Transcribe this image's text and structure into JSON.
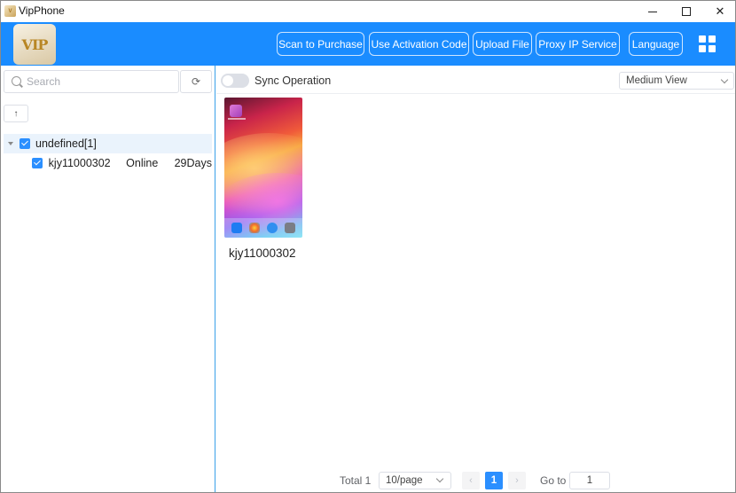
{
  "window": {
    "title": "VipPhone",
    "app_icon": "vip-app-icon"
  },
  "header": {
    "logo_text": "VIP",
    "buttons": [
      {
        "label": "Scan to Purchase"
      },
      {
        "label": "Use Activation Code"
      },
      {
        "label": "Upload File"
      },
      {
        "label": "Proxy IP Service"
      },
      {
        "label": "Language"
      }
    ],
    "layout_icon": "grid-icon",
    "accent_color": "#1a8cff"
  },
  "sidebar": {
    "search_placeholder": "Search",
    "up_label": "↑",
    "groups": [
      {
        "label": "undefined[1]",
        "devices": [
          {
            "name": "kjy11000302",
            "status": "Online",
            "remaining": "29Days"
          }
        ]
      }
    ]
  },
  "main": {
    "sync_label": "Sync Operation",
    "sync_on": false,
    "view_mode": "Medium View",
    "devices": [
      {
        "name": "kjy11000302"
      }
    ]
  },
  "pagination": {
    "total": "Total 1",
    "page_size": "10/page",
    "current_page": "1",
    "prev": "‹",
    "next": "›",
    "goto_label": "Go to",
    "goto_value": "1"
  }
}
